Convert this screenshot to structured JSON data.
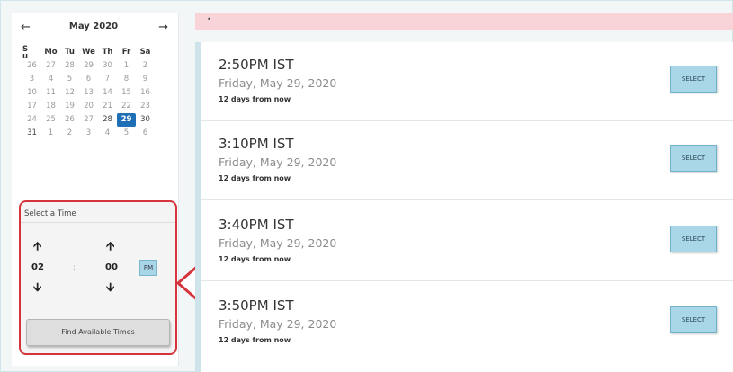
{
  "calendar": {
    "title": "May 2020",
    "prev_icon": "arrow-left-icon",
    "next_icon": "arrow-right-icon",
    "days_of_week": [
      "S u",
      "Mo",
      "Tu",
      "We",
      "Th",
      "Fr",
      "Sa"
    ],
    "weeks": [
      [
        "26",
        "27",
        "28",
        "29",
        "30",
        "1",
        "2"
      ],
      [
        "3",
        "4",
        "5",
        "6",
        "7",
        "8",
        "9"
      ],
      [
        "10",
        "11",
        "12",
        "13",
        "14",
        "15",
        "16"
      ],
      [
        "17",
        "18",
        "19",
        "20",
        "21",
        "22",
        "23"
      ],
      [
        "24",
        "25",
        "26",
        "27",
        "28",
        "29",
        "30"
      ],
      [
        "31",
        "1",
        "2",
        "3",
        "4",
        "5",
        "6"
      ]
    ],
    "selected": "29",
    "selected_color": "#1f6fb7"
  },
  "time_picker": {
    "title": "Select a Time",
    "hour": "02",
    "separator": ":",
    "minute": "00",
    "ampm": "PM",
    "up_icon": "arrow-up-icon",
    "down_icon": "arrow-down-icon",
    "find_button": "Find Available Times",
    "highlight_color": "#d4343a"
  },
  "slots": [
    {
      "time": "2:50PM IST",
      "date": "Friday, May 29, 2020",
      "relative": "12 days from now",
      "button": "SELECT"
    },
    {
      "time": "3:10PM IST",
      "date": "Friday, May 29, 2020",
      "relative": "12 days from now",
      "button": "SELECT"
    },
    {
      "time": "3:40PM IST",
      "date": "Friday, May 29, 2020",
      "relative": "12 days from now",
      "button": "SELECT"
    },
    {
      "time": "3:50PM IST",
      "date": "Friday, May 29, 2020",
      "relative": "12 days from now",
      "button": "SELECT"
    }
  ],
  "colors": {
    "alert_bar": "#f8d4d8",
    "select_button": "#a9d7e8",
    "pointer_arrow": "#d4343a"
  }
}
